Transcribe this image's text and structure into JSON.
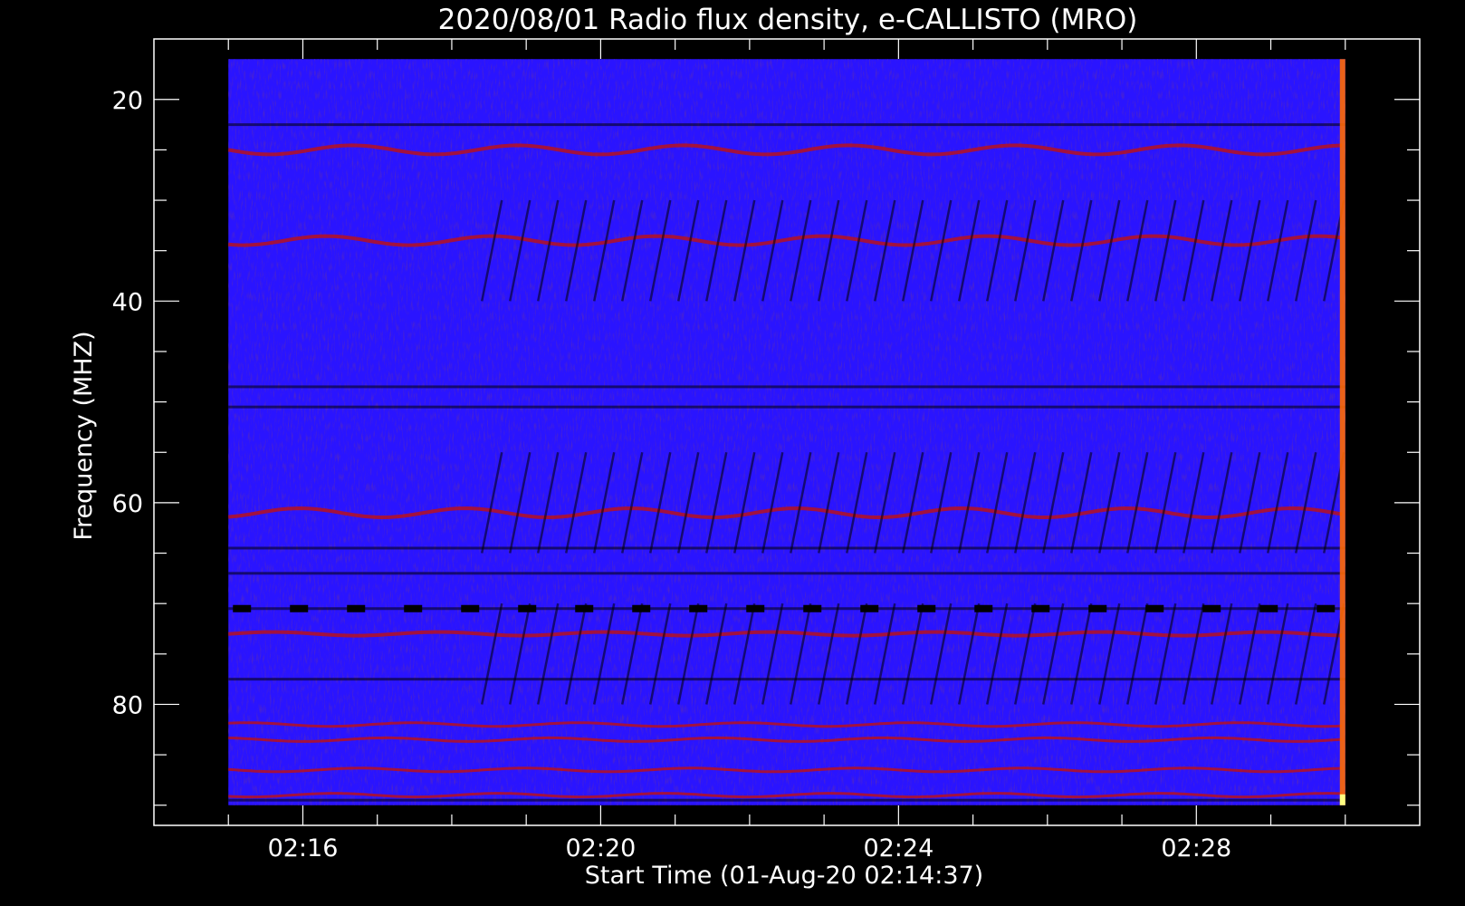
{
  "chart_data": {
    "type": "heatmap",
    "title": "2020/08/01  Radio flux density, e-CALLISTO (MRO)",
    "xlabel": "Start Time (01-Aug-20 02:14:37)",
    "ylabel": "Frequency (MHZ)",
    "y_inverted": true,
    "xlim": [
      "02:14:00",
      "02:31:00"
    ],
    "data_time_range": [
      "02:15:00",
      "02:30:00"
    ],
    "ylim": [
      14,
      92
    ],
    "data_freq_range": [
      16,
      90
    ],
    "x_ticks": [
      "02:16",
      "02:20",
      "02:24",
      "02:28"
    ],
    "x_tick_minutes": [
      16,
      20,
      24,
      28
    ],
    "x_minor_tick_minutes": [
      15,
      16,
      17,
      18,
      19,
      20,
      21,
      22,
      23,
      24,
      25,
      26,
      27,
      28,
      29,
      30
    ],
    "y_ticks": [
      20,
      40,
      60,
      80
    ],
    "y_minor_ticks": [
      20,
      25,
      30,
      35,
      40,
      45,
      50,
      55,
      60,
      65,
      70,
      75,
      80,
      85,
      90
    ],
    "colormap": [
      "#000000",
      "#0000c8",
      "#2a14ff",
      "#c01010",
      "#ff6a00",
      "#ffff80"
    ],
    "emission_bands_mhz": [
      25,
      34,
      61,
      73,
      82,
      83.5,
      86.5,
      89
    ],
    "dark_bands_mhz": [
      22.5,
      48.5,
      50.5,
      64.5,
      67,
      70.5,
      77.5,
      89.5
    ],
    "grid": false
  }
}
